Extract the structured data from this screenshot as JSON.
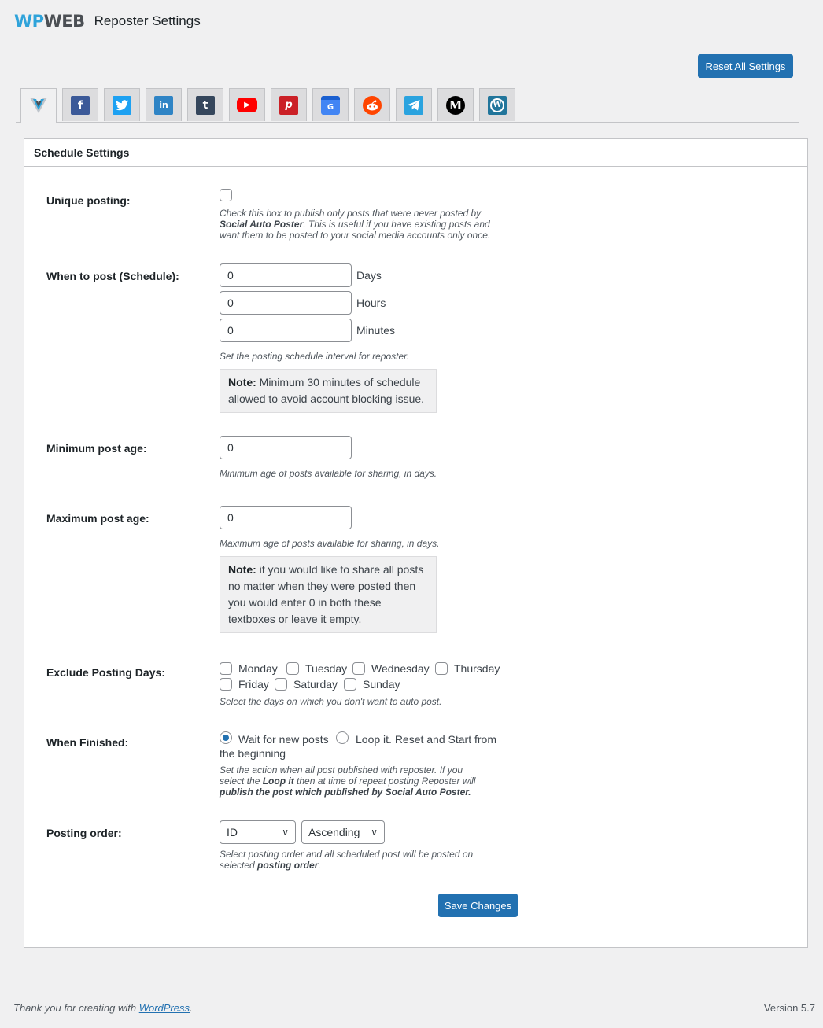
{
  "header": {
    "logo_wp": "WP",
    "logo_web": "WEB",
    "title": "Reposter Settings"
  },
  "reset_button": "Reset All Settings",
  "tabs": [
    {
      "name": "wpweb",
      "icon": "wpweb-logo-icon",
      "active": true
    },
    {
      "name": "facebook",
      "icon": "facebook-icon",
      "glyph": "f",
      "color": "#3b5998"
    },
    {
      "name": "twitter",
      "icon": "twitter-icon",
      "glyph": "🐦",
      "color": "#1da1f2"
    },
    {
      "name": "linkedin",
      "icon": "linkedin-icon",
      "glyph": "in",
      "color": "#2f84c5"
    },
    {
      "name": "tumblr",
      "icon": "tumblr-icon",
      "glyph": "t",
      "color": "#35465c"
    },
    {
      "name": "youtube",
      "icon": "youtube-icon",
      "glyph": "▶",
      "color": "#ff0000"
    },
    {
      "name": "pinterest",
      "icon": "pinterest-icon",
      "glyph": "p",
      "color": "#cb2027"
    },
    {
      "name": "google-my-business",
      "icon": "google-business-icon",
      "glyph": "G",
      "color": "#4285f4"
    },
    {
      "name": "reddit",
      "icon": "reddit-icon",
      "glyph": "●",
      "color": "#ff4500"
    },
    {
      "name": "telegram",
      "icon": "telegram-icon",
      "glyph": "➤",
      "color": "#2aa3df"
    },
    {
      "name": "medium",
      "icon": "medium-icon",
      "glyph": "M",
      "color": "#000000"
    },
    {
      "name": "wordpress",
      "icon": "wordpress-icon",
      "glyph": "W",
      "color": "#21759b"
    }
  ],
  "panel": {
    "title": "Schedule Settings",
    "unique_posting": {
      "label": "Unique posting:",
      "checked": false,
      "desc_1": "Check this box to publish only posts that were never posted by",
      "desc_bold": "Social Auto Poster",
      "desc_2": ". This is useful if you have existing posts and",
      "desc_3": "want them to be posted to your social media accounts only once."
    },
    "schedule": {
      "label": "When to post (Schedule):",
      "days_value": "0",
      "days_unit": "Days",
      "hours_value": "0",
      "hours_unit": "Hours",
      "minutes_value": "0",
      "minutes_unit": "Minutes",
      "desc": "Set the posting schedule interval for reposter.",
      "note_bold": "Note:",
      "note_1": " Minimum 30 minutes of schedule",
      "note_2": "allowed to avoid account blocking issue."
    },
    "min_age": {
      "label": "Minimum post age:",
      "value": "0",
      "desc": "Minimum age of posts available for sharing, in days."
    },
    "max_age": {
      "label": "Maximum post age:",
      "value": "0",
      "desc": "Maximum age of posts available for sharing, in days.",
      "note_bold": "Note:",
      "note_1": " if you would like to share all posts",
      "note_2": "no matter when they were posted then",
      "note_3": "you would enter 0 in both these",
      "note_4": "textboxes or leave it empty."
    },
    "exclude_days": {
      "label": "Exclude Posting Days:",
      "days": [
        "Monday",
        "Tuesday",
        "Wednesday",
        "Thursday",
        "Friday",
        "Saturday",
        "Sunday"
      ],
      "desc": "Select the days on which you don't want to auto post."
    },
    "when_finished": {
      "label": "When Finished:",
      "option_wait": "Wait for new posts",
      "option_loop_1": "Loop it. Reset and Start from",
      "option_loop_2": "the beginning",
      "selected": "wait",
      "desc_1": "Set the action when all post published with reposter. If you",
      "desc_2a": "select the ",
      "desc_2b": "Loop it",
      "desc_2c": " then at time of repeat posting Reposter will",
      "desc_3": "publish the post which published by Social Auto Poster."
    },
    "posting_order": {
      "label": "Posting order:",
      "order_by": "ID",
      "direction": "Ascending",
      "desc_1": "Select posting order and all scheduled post will be posted on",
      "desc_2a": "selected ",
      "desc_2b": "posting order",
      "desc_2c": "."
    },
    "save_button": "Save Changes"
  },
  "footer": {
    "thanks": "Thank you for creating with ",
    "link": "WordPress",
    "thanks_end": ".",
    "version": "Version 5.7"
  }
}
